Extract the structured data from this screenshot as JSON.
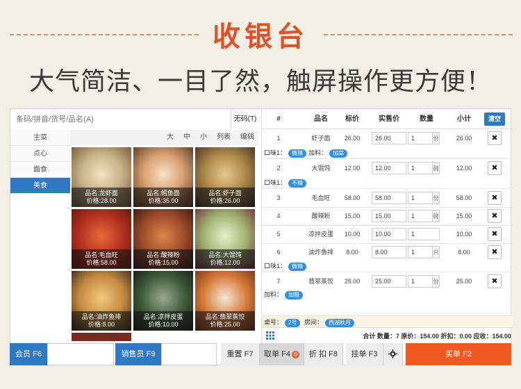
{
  "title": "收银台",
  "subtitle": "大气简洁、一目了然，触屏操作更方便！",
  "search": {
    "placeholder": "条码/拼音/货号/品名(A)",
    "nocode_label": "无码(T)"
  },
  "categories": [
    {
      "label": "主菜",
      "active": false
    },
    {
      "label": "点心",
      "active": false
    },
    {
      "label": "面食",
      "active": false
    },
    {
      "label": "美食",
      "active": true
    }
  ],
  "view_options": [
    "大",
    "中",
    "小",
    "列表",
    "编辑"
  ],
  "dishes": [
    {
      "name": "品名:龙虾面",
      "price": "价格:28.00",
      "color": "#c9b48a"
    },
    {
      "name": "品名:鳕鱼面",
      "price": "价格:35.00",
      "color": "#d9a070"
    },
    {
      "name": "品名:虾子面",
      "price": "价格:26.00",
      "color": "#b08a4c"
    },
    {
      "name": "品名:毛血旺",
      "price": "价格:58.00",
      "color": "#b2301e"
    },
    {
      "name": "品名:酸辣粉",
      "price": "价格:15.00",
      "color": "#9c4a2a"
    },
    {
      "name": "品名:大馄饨",
      "price": "价格:12.00",
      "color": "#9fb070"
    },
    {
      "name": "品名:油炸鱼排",
      "price": "价格:8.00",
      "color": "#c68a3e"
    },
    {
      "name": "品名:凉拌皮蛋",
      "price": "价格:10.00",
      "color": "#3f5a3a"
    },
    {
      "name": "品名:翡翠蒸饺",
      "price": "价格:25.00",
      "color": "#d77a3a"
    }
  ],
  "table_headers": {
    "no": "#",
    "name": "品名",
    "price": "标价",
    "actual": "实售价",
    "qty": "数量",
    "subtotal": "小计",
    "clear": "清空"
  },
  "order_rows": [
    {
      "no": "1",
      "name": "虾子面",
      "price": "26.00",
      "actual": "26.00",
      "qty": "1",
      "unit": "份",
      "subtotal": "26.00"
    },
    {
      "no": "2",
      "name": "大馄饨",
      "price": "12.00",
      "actual": "12.00",
      "qty": "1",
      "unit": "碗",
      "subtotal": "12.00"
    },
    {
      "no": "3",
      "name": "毛血旺",
      "price": "58.00",
      "actual": "58.00",
      "qty": "1",
      "unit": "份",
      "subtotal": "58.00"
    },
    {
      "no": "4",
      "name": "酸辣粉",
      "price": "15.00",
      "actual": "15.00",
      "qty": "1",
      "unit": "碗",
      "subtotal": "15.00"
    },
    {
      "no": "5",
      "name": "凉拌皮蛋",
      "price": "10.00",
      "actual": "10.00",
      "qty": "1",
      "unit": "",
      "subtotal": "10.00"
    },
    {
      "no": "6",
      "name": "油炸鱼排",
      "price": "8.00",
      "actual": "8.00",
      "qty": "1",
      "unit": "只",
      "subtotal": "8.00"
    },
    {
      "no": "7",
      "name": "翡翠蒸饺",
      "price": "25.00",
      "actual": "25.00",
      "qty": "1",
      "unit": "份",
      "subtotal": "25.00"
    }
  ],
  "notes": {
    "r1": {
      "taste_label": "口味1：",
      "taste_tag": "微辣",
      "add_label": "加料：",
      "add_tag": "加蒜"
    },
    "r2": {
      "taste_label": "口味1：",
      "taste_tag": "不辣"
    },
    "r6": {
      "taste_label": "口味1：",
      "taste_tag": "微辣"
    },
    "r7": {
      "add_label": "加料：",
      "add_tag": "加醋"
    }
  },
  "table_info": {
    "desk_label": "桌号：",
    "desk": "2号",
    "room_label": "房间：",
    "room": "西湖秋月"
  },
  "summary": "合计 数量：7 原价：154.00 折扣：0.00 应收：154.00",
  "bottom": {
    "member": "会员 F6",
    "seller": "销售员 F9",
    "reset": "重置 F7",
    "fetch": "取单 F4",
    "fetch_badge": "0",
    "discount": "折 扣 F8",
    "hold": "挂单 F3",
    "checkout": "买单 F2"
  },
  "colors": {
    "accent": "#2f78c4",
    "orange": "#f05a22",
    "title": "#e0502a"
  }
}
